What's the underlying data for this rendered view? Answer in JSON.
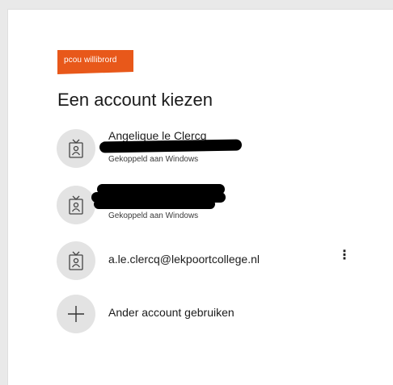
{
  "brand": {
    "logo_text": "pcou willibrord",
    "color": "#e8581a"
  },
  "title": "Een account kiezen",
  "accounts": [
    {
      "name": "Angelique le Clercq",
      "subtitle": "Gekoppeld aan Windows",
      "icon": "contact-badge-icon",
      "email_redacted": true
    },
    {
      "name": "",
      "subtitle": "Gekoppeld aan Windows",
      "icon": "contact-badge-icon",
      "name_redacted": true
    },
    {
      "name": "a.le.clercq@lekpoortcollege.nl",
      "icon": "contact-badge-icon",
      "more_options": "⋮"
    }
  ],
  "other_account": {
    "label": "Ander account gebruiken",
    "icon": "plus-icon"
  }
}
